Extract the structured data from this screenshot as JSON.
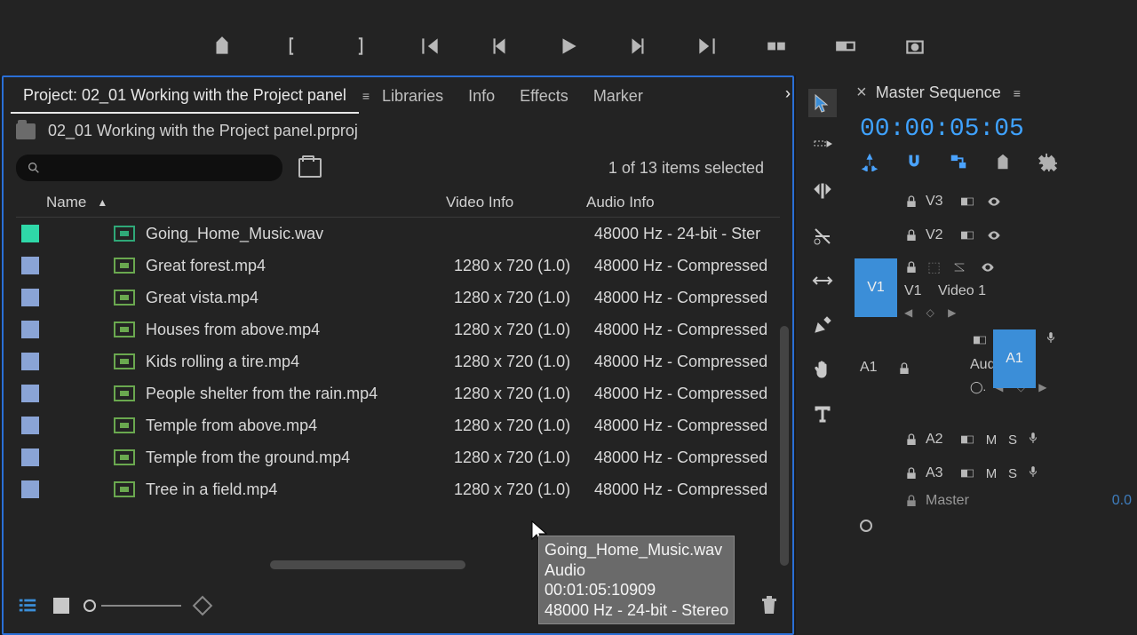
{
  "top_toolbar": {
    "icons": [
      "marker-in",
      "bracket-left",
      "bracket-right",
      "go-to-in",
      "step-back",
      "play",
      "step-forward",
      "go-to-out",
      "insert",
      "overwrite",
      "export-frame"
    ]
  },
  "project": {
    "tabs": [
      "Project: 02_01 Working with the Project panel",
      "Libraries",
      "Info",
      "Effects",
      "Marker"
    ],
    "active_tab": 0,
    "file_name": "02_01 Working with the Project panel.prproj",
    "selection_text": "1 of 13 items selected",
    "columns": {
      "name": "Name",
      "frame": "",
      "video": "Video Info",
      "audio": "Audio Info"
    },
    "rows": [
      {
        "type": "audio",
        "name": "Going_Home_Music.wav",
        "video": "",
        "audio": "48000 Hz - 24-bit - Ster"
      },
      {
        "type": "video",
        "name": "Great forest.mp4",
        "video": "1280 x 720 (1.0)",
        "audio": "48000 Hz - Compressed"
      },
      {
        "type": "video",
        "name": "Great vista.mp4",
        "video": "1280 x 720 (1.0)",
        "audio": "48000 Hz - Compressed"
      },
      {
        "type": "video",
        "name": "Houses from above.mp4",
        "video": "1280 x 720 (1.0)",
        "audio": "48000 Hz - Compressed"
      },
      {
        "type": "video",
        "name": "Kids rolling a tire.mp4",
        "video": "1280 x 720 (1.0)",
        "audio": "48000 Hz - Compressed"
      },
      {
        "type": "video",
        "name": "People shelter from the rain.mp4",
        "video": "1280 x 720 (1.0)",
        "audio": "48000 Hz - Compressed"
      },
      {
        "type": "video",
        "name": "Temple from above.mp4",
        "video": "1280 x 720 (1.0)",
        "audio": "48000 Hz - Compressed"
      },
      {
        "type": "video",
        "name": "Temple from the ground.mp4",
        "video": "1280 x 720 (1.0)",
        "audio": "48000 Hz - Compressed"
      },
      {
        "type": "video",
        "name": "Tree in a field.mp4",
        "video": "1280 x 720 (1.0)",
        "audio": "48000 Hz - Compressed"
      }
    ]
  },
  "tooltip": {
    "line1": "Going_Home_Music.wav",
    "line2": "Audio",
    "line3": "00:01:05:10909",
    "line4": "48000 Hz - 24-bit - Stereo"
  },
  "tools": [
    "selection",
    "track-select",
    "ripple-edit",
    "rate-stretch",
    "razor",
    "slip",
    "hand",
    "type"
  ],
  "timeline": {
    "seq_name": "Master Sequence",
    "timecode": "00:00:05:05",
    "video_tracks": [
      {
        "label": "V3"
      },
      {
        "label": "V2"
      },
      {
        "label": "V1",
        "src": "V1",
        "name": "Video 1"
      }
    ],
    "audio_tracks": [
      {
        "label": "A1",
        "src": "A1",
        "name": "Audio 1"
      },
      {
        "label": "A2"
      },
      {
        "label": "A3"
      }
    ],
    "master": "Master",
    "master_val": "0.0"
  }
}
